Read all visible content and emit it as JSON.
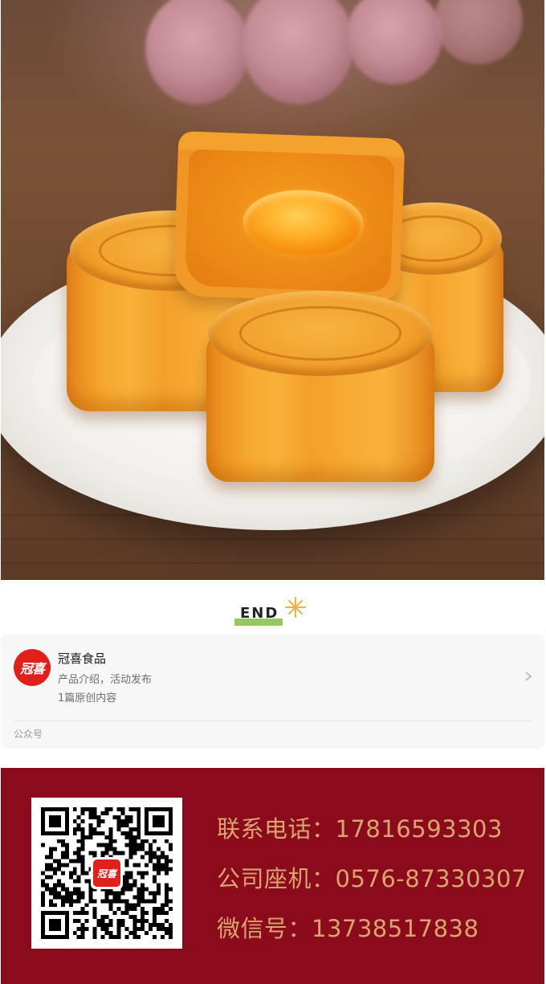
{
  "hero": {
    "image": "mooncakes-on-plate-photo"
  },
  "divider": {
    "end_label": "END",
    "star_icon": "sparkle-icon"
  },
  "account": {
    "avatar_text": "冠喜",
    "name": "冠喜食品",
    "description": "产品介绍，活动发布",
    "original_count": "1篇原创内容",
    "type_label": "公众号",
    "chevron_icon": "chevron-right-icon"
  },
  "contact": {
    "qr_logo_text": "冠喜",
    "phone": "联系电话：17816593303",
    "landline": "公司座机：0576-87330307",
    "wechat": "微信号：13738517838"
  },
  "colors": {
    "banner_bg": "#8b0a1c",
    "contact_text": "#d9a56f",
    "brand_red": "#e1201b",
    "end_underline": "#8bc34a"
  }
}
